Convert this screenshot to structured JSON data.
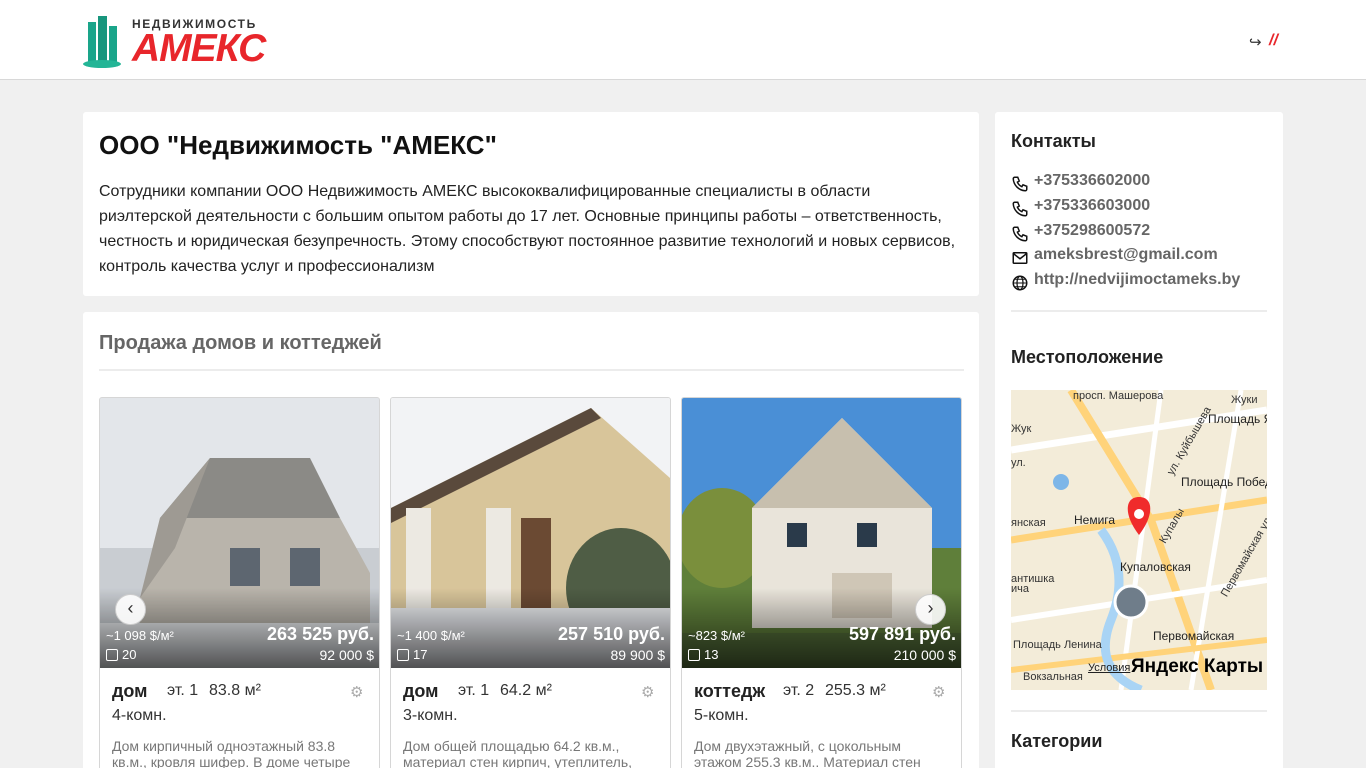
{
  "brand": {
    "caption": "НЕДВИЖИМОСТЬ",
    "word": "АМЕКС"
  },
  "about": {
    "title": "ООО \"Недвижимость \"АМЕКС\"",
    "text": "Сотрудники компании ООО Недвижимость АМЕКС высококвалифицированные специалисты в области риэлтерской деятельности с большим опытом работы до 17 лет. Основные принципы работы – ответственность, честность и юридическая безупречность. Этому способствуют постоянное развитие технологий и новых сервисов, контроль качества услуг и профессионализм"
  },
  "listings": {
    "heading": "Продажа домов и коттеджей",
    "items": [
      {
        "price_rub": "263 525 руб.",
        "price_usd": "92 000 $",
        "per_m2": "~1 098 $/м²",
        "photos": "20",
        "type": "дом",
        "floor": "эт. 1",
        "area": "83.8 м²",
        "rooms": "4-комн.",
        "desc": "Дом кирпичный одноэтажный 83.8 кв.м., кровля шифер. В доме четыре"
      },
      {
        "price_rub": "257 510 руб.",
        "price_usd": "89 900 $",
        "per_m2": "~1 400 $/м²",
        "photos": "17",
        "type": "дом",
        "floor": "эт. 1",
        "area": "64.2 м²",
        "rooms": "3-комн.",
        "desc": "Дом общей площадью 64.2 кв.м., материал стен кирпич, утеплитель,"
      },
      {
        "price_rub": "597 891 руб.",
        "price_usd": "210 000 $",
        "per_m2": "~823 $/м²",
        "photos": "13",
        "type": "коттедж",
        "floor": "эт. 2",
        "area": "255.3 м²",
        "rooms": "5-комн.",
        "desc": "Дом двухэтажный, с цокольным этажом 255.3 кв.м.. Материал стен"
      }
    ],
    "prev": "‹",
    "next": "›"
  },
  "sidebar": {
    "contacts_title": "Контакты",
    "contacts": [
      {
        "icon": "phone-icon",
        "text": "+375336602000"
      },
      {
        "icon": "phone-icon",
        "text": "+375336603000"
      },
      {
        "icon": "phone-icon",
        "text": "+375298600572"
      },
      {
        "icon": "mail-icon",
        "text": "ameksbrest@gmail.com"
      },
      {
        "icon": "globe-icon",
        "text": "http://nedvijimoctameks.by"
      }
    ],
    "location_title": "Местоположение",
    "categories_title": "Категории",
    "map": {
      "labels": [
        "просп. Машерова",
        "Площадь Я",
        "ул. Куйбышева",
        "Площадь Победы",
        "Немига",
        "Купаловская",
        "Первомайская ул.",
        "Купалы",
        "Первомайская",
        "Площадь Ленина",
        "Вокзальная",
        "ул.",
        "Жуки",
        "янская",
        "антишка",
        "ича",
        "Жук"
      ],
      "terms": "Условия",
      "brand": "Яндекс Карты"
    }
  },
  "colors": {
    "brand_red": "#e8262b",
    "brand_green": "#1aa58a",
    "background": "#f0f0f0"
  }
}
